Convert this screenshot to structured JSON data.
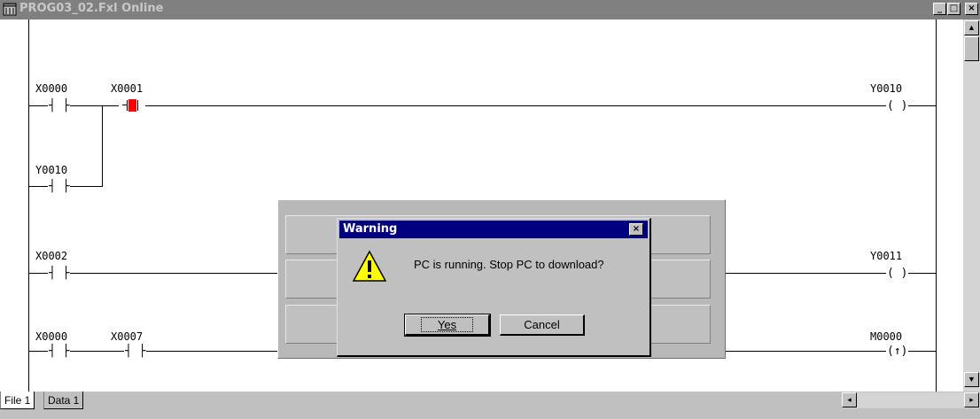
{
  "window": {
    "title": "PROG03_02.Fxl Online",
    "min_label": "_",
    "max_label": "□",
    "close_label": "×"
  },
  "ladder": {
    "rung1": {
      "c1": "X0000",
      "c2": "X0001",
      "coil": "Y0010"
    },
    "rung1_branch": {
      "c1": "Y0010"
    },
    "rung2": {
      "c1": "X0002",
      "coil": "Y0011"
    },
    "rung3": {
      "c1": "X0000",
      "c2": "X0007",
      "coil": "M0000"
    },
    "contact_glyph": "┤ ├",
    "coil_glyph": "( )",
    "pulse_coil_glyph": "(↑)"
  },
  "tabs": [
    "File 1",
    "Data 1"
  ],
  "dialog": {
    "title": "Warning",
    "close_label": "×",
    "message": "PC is running. Stop PC to download?",
    "yes_label": "Yes",
    "cancel_label": "Cancel"
  },
  "colors": {
    "highlight": "#ff0000",
    "dialog_title_bg": "#000080",
    "window_title_bg": "#808080"
  }
}
